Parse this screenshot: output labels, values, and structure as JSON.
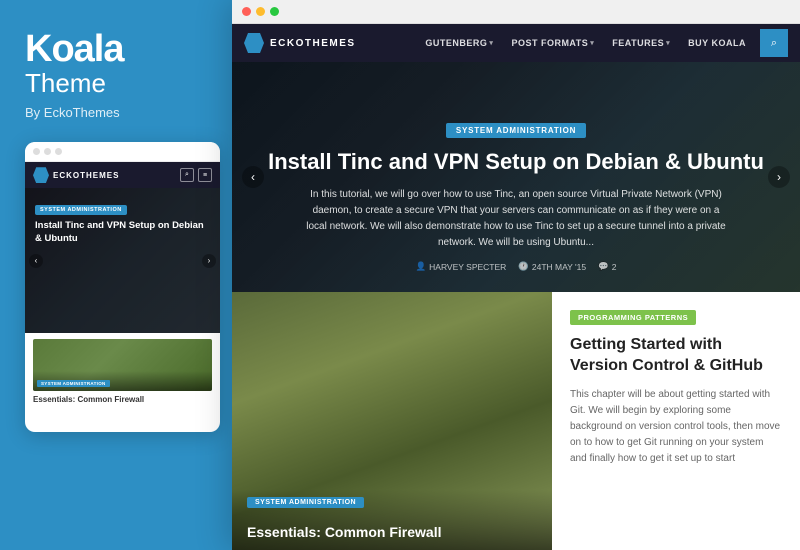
{
  "brand": {
    "title": "Koala",
    "subtitle": "Theme",
    "by": "By EckoThemes"
  },
  "mobile": {
    "nav": {
      "logo_text": "ECKOTHEMES"
    },
    "hero": {
      "category": "SYSTEM ADMINISTRATION",
      "title": "Install Tinc and VPN Setup on Debian & Ubuntu"
    },
    "card": {
      "category": "SYSTEM ADMINISTRATION",
      "title": "Essentials: Common Firewall"
    }
  },
  "desktop": {
    "titlebar_dots": [
      "red",
      "yellow",
      "green"
    ],
    "nav": {
      "logo_text": "ECKOTHEMES",
      "items": [
        {
          "label": "GUTENBERG",
          "has_caret": true
        },
        {
          "label": "POST FORMATS",
          "has_caret": true
        },
        {
          "label": "FEATURES",
          "has_caret": true
        },
        {
          "label": "BUY KOALA",
          "has_caret": false
        }
      ]
    },
    "hero": {
      "category": "SYSTEM ADMINISTRATION",
      "title": "Install Tinc and VPN Setup on Debian & Ubuntu",
      "excerpt": "In this tutorial, we will go over how to use Tinc, an open source Virtual Private Network (VPN) daemon, to create a secure VPN that your servers can communicate on as if they were on a local network. We will also demonstrate how to use Tinc to set up a secure tunnel into a private network. We will be using Ubuntu...",
      "meta_author": "HARVEY SPECTER",
      "meta_date": "24TH MAY '15",
      "meta_comments": "2"
    },
    "food_card": {
      "category": "SYSTEM ADMINISTRATION",
      "title": "Essentials: Common Firewall"
    },
    "article_card": {
      "category": "PROGRAMMING PATTERNS",
      "title": "Getting Started with Version Control & GitHub",
      "excerpt": "This chapter will be about getting started with Git. We will begin by exploring some background on version control tools, then move on to how to get Git running on your system and finally how to get it set up to start"
    }
  }
}
